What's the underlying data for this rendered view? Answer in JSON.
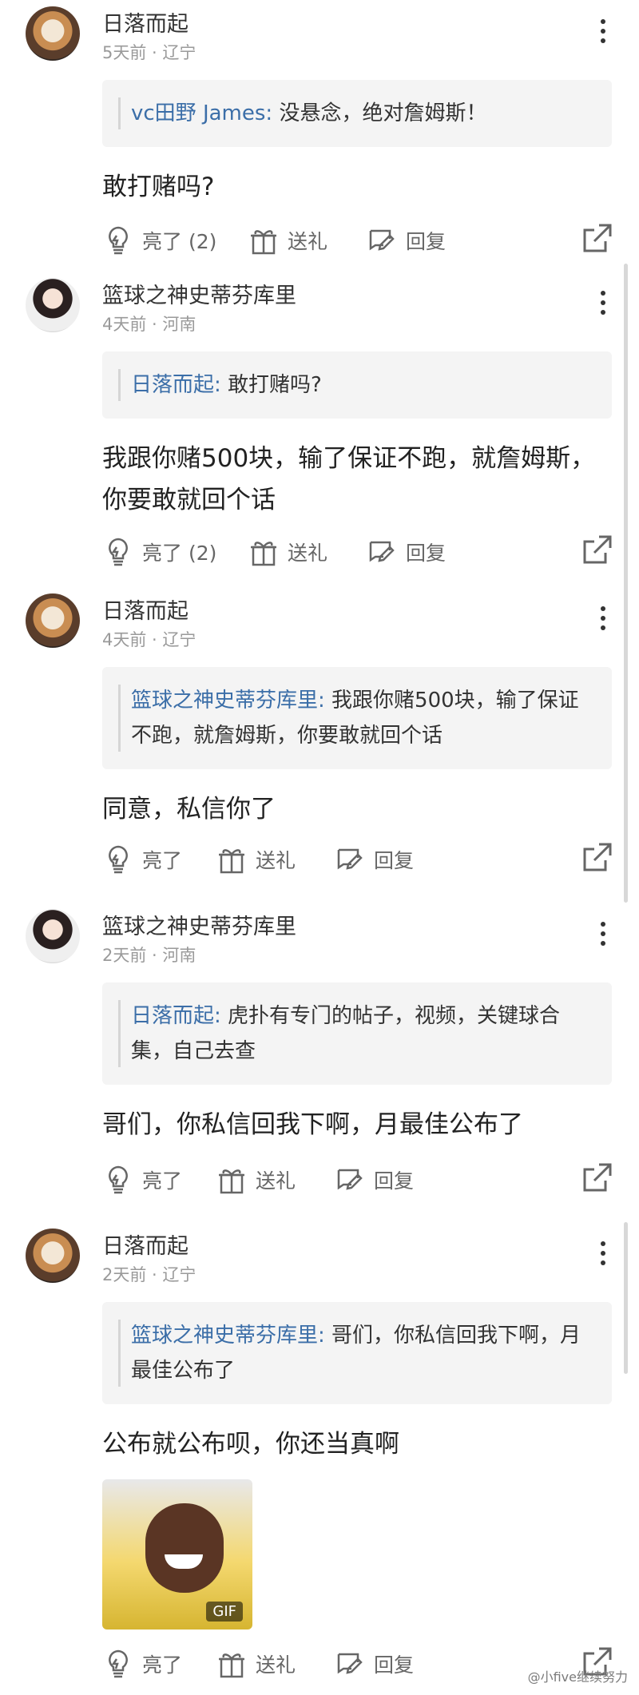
{
  "comments": [
    {
      "name": "日落而起",
      "meta": "5天前 · 辽宁",
      "quote_name": "vc田野 James:",
      "quote_text": "没悬念，绝对詹姆斯！",
      "body": "敢打赌吗?",
      "like": "亮了 (2)",
      "gift": "送礼",
      "reply": "回复"
    },
    {
      "name": "篮球之神史蒂芬库里",
      "meta": "4天前 · 河南",
      "quote_name": "日落而起:",
      "quote_text": "敢打赌吗?",
      "body": "我跟你赌500块，输了保证不跑，就詹姆斯，你要敢就回个话",
      "like": "亮了 (2)",
      "gift": "送礼",
      "reply": "回复"
    },
    {
      "name": "日落而起",
      "meta": "4天前 · 辽宁",
      "quote_name": "篮球之神史蒂芬库里:",
      "quote_text": "我跟你赌500块，输了保证不跑，就詹姆斯，你要敢就回个话",
      "body": "同意，私信你了",
      "like": "亮了",
      "gift": "送礼",
      "reply": "回复"
    },
    {
      "name": "篮球之神史蒂芬库里",
      "meta": "2天前 · 河南",
      "quote_name": "日落而起:",
      "quote_text": "虎扑有专门的帖子，视频，关键球合集，自己去查",
      "body": "哥们，你私信回我下啊，月最佳公布了",
      "like": "亮了",
      "gift": "送礼",
      "reply": "回复"
    },
    {
      "name": "日落而起",
      "meta": "2天前 · 辽宁",
      "quote_name": "篮球之神史蒂芬库里:",
      "quote_text": "哥们，你私信回我下啊，月最佳公布了",
      "body": "公布就公布呗，你还当真啊",
      "gif_label": "GIF",
      "like": "亮了",
      "gift": "送礼",
      "reply": "回复"
    }
  ],
  "watermark": "@小five继续努力"
}
